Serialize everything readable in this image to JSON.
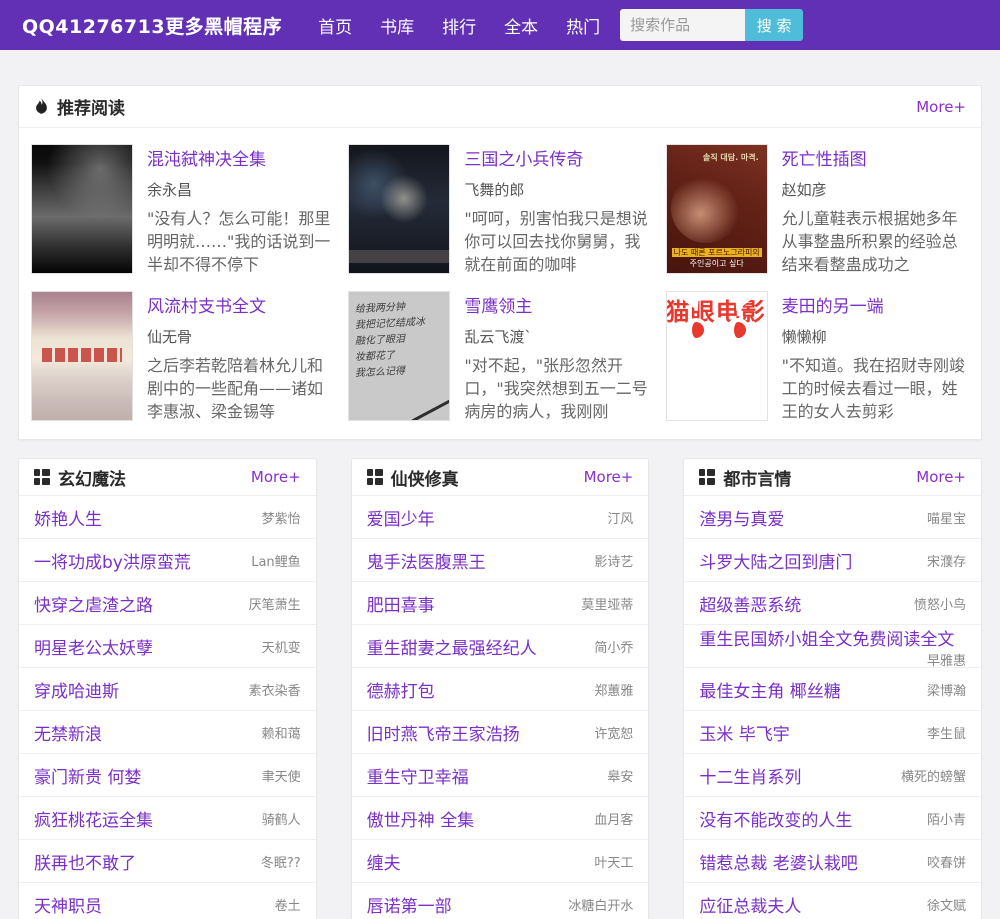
{
  "colors": {
    "header_bg": "#6130b5",
    "link": "#7b2fc9",
    "more": "#8a2fd0",
    "search_btn": "#4fbcd9",
    "maoyan_red": "#e8392e"
  },
  "header": {
    "logo": "QQ41276713更多黑帽程序",
    "nav": [
      "首页",
      "书库",
      "排行",
      "全本",
      "热门"
    ],
    "search": {
      "placeholder": "搜索作品",
      "button": "搜 索"
    }
  },
  "recommended": {
    "title": "推荐阅读",
    "more": "More+",
    "books": [
      {
        "title": "混沌弑神决全集",
        "author": "余永昌",
        "desc": "\"没有人？怎么可能！那里明明就……\"我的话说到一半却不得不停下"
      },
      {
        "title": "三国之小兵传奇",
        "author": "飞舞的郎",
        "desc": "\"呵呵，别害怕我只是想说你可以回去找你舅舅，我就在前面的咖啡"
      },
      {
        "title": "死亡性插图",
        "author": "赵如彦",
        "desc": "允儿童鞋表示根据她多年从事整蛊所积累的经验总结来看整蛊成功之",
        "cover_top_text": "솔직 대담. 마격.",
        "cover_bottom_text_1": "나도 때론 포르노그라피의",
        "cover_bottom_text_2": "주인공이고 싶다"
      },
      {
        "title": "风流村支书全文",
        "author": "仙无骨",
        "desc": "之后李若乾陪着林允儿和剧中的一些配角——诸如李惠淑、梁金锡等"
      },
      {
        "title": "雪鹰领主",
        "author": "乱云飞渡`",
        "desc": "\"对不起，\"张彤忽然开口，\"我突然想到五一二号病房的病人，我刚刚",
        "cover_lines": [
          "给我两分钟",
          "我把记忆结成冰",
          "融化了眼泪",
          "妆都花了",
          "我怎么记得"
        ]
      },
      {
        "title": "麦田的另一端",
        "author": "懒懒柳",
        "desc": "\"不知道。我在招财寺刚竣工的时候去看过一眼，姓王的女人去剪彩",
        "cover_logo_text": "猫眼电影"
      }
    ]
  },
  "categories": [
    {
      "title": "玄幻魔法",
      "more": "More+",
      "books": [
        {
          "title": "娇艳人生",
          "author": "梦紫怡"
        },
        {
          "title": "一将功成by洪原蛮荒",
          "author": "Lan鲤鱼"
        },
        {
          "title": "快穿之虐渣之路",
          "author": "厌笔萧生"
        },
        {
          "title": "明星老公太妖孽",
          "author": "天机变"
        },
        {
          "title": "穿成哈迪斯",
          "author": "素衣染香"
        },
        {
          "title": "无禁新浪",
          "author": "赖和蔼"
        },
        {
          "title": "豪门新贵 何婪",
          "author": "聿天使"
        },
        {
          "title": "疯狂桃花运全集",
          "author": "骑鹤人"
        },
        {
          "title": "朕再也不敢了",
          "author": "冬眠??"
        },
        {
          "title": "天神职员",
          "author": "卷土"
        }
      ]
    },
    {
      "title": "仙侠修真",
      "more": "More+",
      "books": [
        {
          "title": "爱国少年",
          "author": "汀风"
        },
        {
          "title": "鬼手法医腹黑王",
          "author": "影诗艺"
        },
        {
          "title": "肥田喜事",
          "author": "莫里垭蒂"
        },
        {
          "title": "重生甜妻之最强经纪人",
          "author": "简小乔"
        },
        {
          "title": "德赫打包",
          "author": "郑蕙雅"
        },
        {
          "title": "旧时燕飞帝王家浩扬",
          "author": "许宽恕"
        },
        {
          "title": "重生守卫幸福",
          "author": "皋安"
        },
        {
          "title": "傲世丹神 全集",
          "author": "血月客"
        },
        {
          "title": "缠夫",
          "author": "叶天工"
        },
        {
          "title": "唇诺第一部",
          "author": "冰糖白开水"
        }
      ]
    },
    {
      "title": "都市言情",
      "more": "More+",
      "books": [
        {
          "title": "渣男与真爱",
          "author": "喵星宝"
        },
        {
          "title": "斗罗大陆之回到唐门",
          "author": "宋濮存"
        },
        {
          "title": "超级善恶系统",
          "author": "愤怒小鸟"
        },
        {
          "title": "重生民国娇小姐全文免费阅读全文",
          "author": "早雅惠"
        },
        {
          "title": "最佳女主角 椰丝糖",
          "author": "梁博瀚"
        },
        {
          "title": "玉米 毕飞宇",
          "author": "李生鼠"
        },
        {
          "title": "十二生肖系列",
          "author": "横死的螃蟹"
        },
        {
          "title": "没有不能改变的人生",
          "author": "陌小青"
        },
        {
          "title": "错惹总裁 老婆认栽吧",
          "author": "咬春饼"
        },
        {
          "title": "应征总裁夫人",
          "author": "徐文赋"
        }
      ]
    }
  ]
}
